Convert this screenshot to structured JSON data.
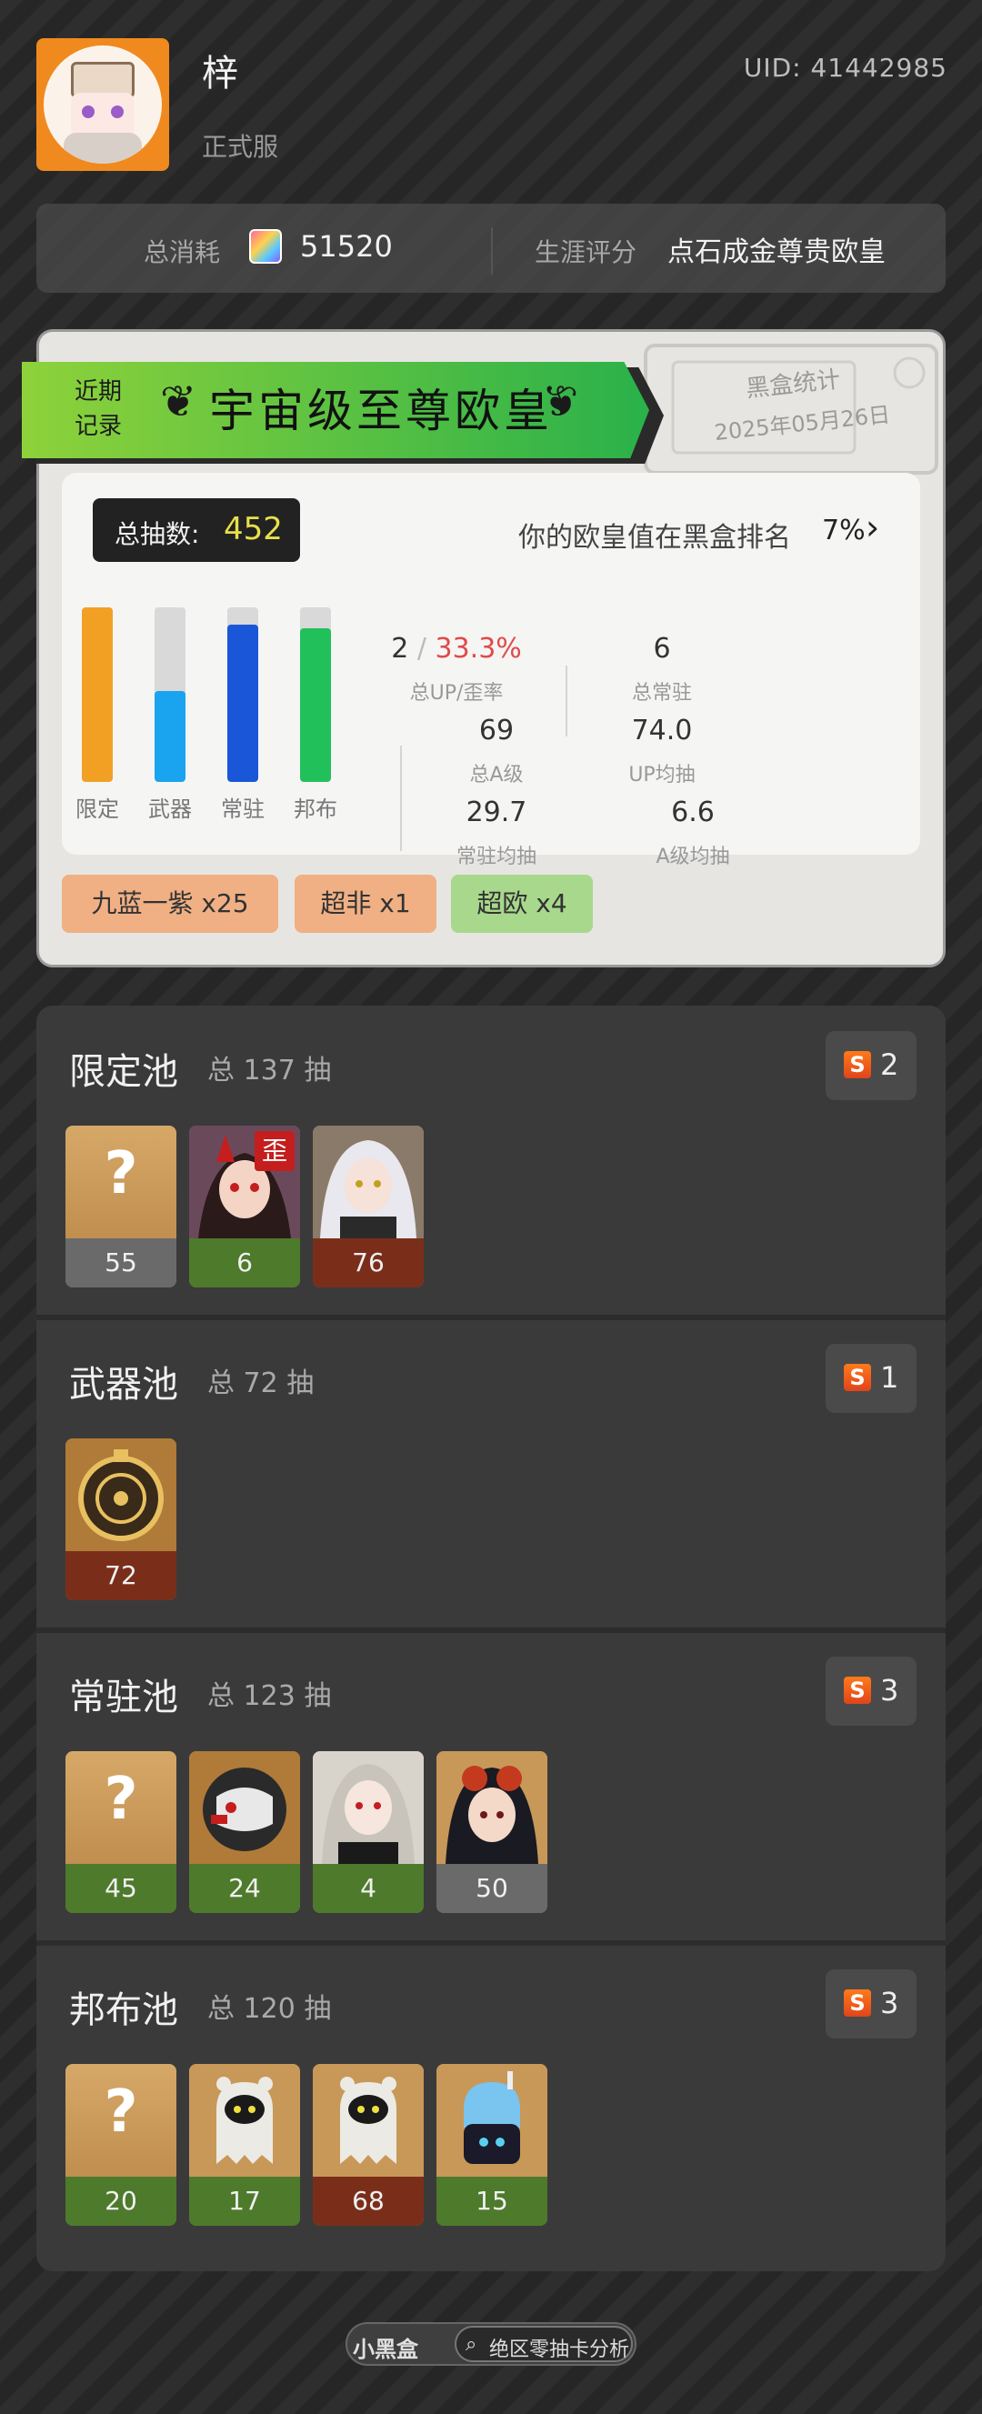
{
  "header": {
    "username": "梓",
    "server": "正式服",
    "uid": "UID: 41442985"
  },
  "stats": {
    "total_label": "总消耗",
    "total_value": "51520",
    "career_label": "生涯评分",
    "career_value": "点石成金尊贵欧皇"
  },
  "record": {
    "badge_line1": "近期",
    "badge_line2": "记录",
    "title": "宇宙级至尊欧皇",
    "stamp_title": "黑盒统计",
    "stamp_date": "2025年05月26日",
    "total_pulls_label": "总抽数:",
    "total_pulls": "452",
    "rank_text": "你的欧皇值在黑盒排名",
    "rank_pct": "7%",
    "bars": [
      {
        "label": "限定",
        "fill": 1.0,
        "color": "#f2a024"
      },
      {
        "label": "武器",
        "fill": 0.52,
        "color": "#1aa4f0"
      },
      {
        "label": "常驻",
        "fill": 0.9,
        "color": "#1a56d8"
      },
      {
        "label": "邦布",
        "fill": 0.88,
        "color": "#22c05a"
      }
    ],
    "s1_a": "2",
    "s1_slash": "/",
    "s1_b": "33.3%",
    "s1_label": "总UP/歪率",
    "s2_val": "6",
    "s2_label": "总常驻",
    "s3_val": "69",
    "s3_label": "总A级",
    "s4_val": "74.0",
    "s4_label": "UP均抽",
    "s5_val": "29.7",
    "s5_label": "常驻均抽",
    "s6_val": "6.6",
    "s6_label": "A级均抽",
    "tags": [
      {
        "text": "九蓝一紫 x25",
        "color": "#f0b084"
      },
      {
        "text": "超非 x1",
        "color": "#f0b084"
      },
      {
        "text": "超欧 x4",
        "color": "#a8d88c"
      }
    ]
  },
  "pools": [
    {
      "name": "限定池",
      "total": "总 137 抽",
      "s_icon": "S",
      "s_count": "2",
      "items": [
        {
          "kind": "unknown",
          "count": "55",
          "num_style": "gray"
        },
        {
          "kind": "agent-red-hair",
          "count": "6",
          "num_style": "green",
          "badge": "歪"
        },
        {
          "kind": "agent-white-hair",
          "count": "76",
          "num_style": "red"
        }
      ]
    },
    {
      "name": "武器池",
      "total": "总 72 抽",
      "s_icon": "S",
      "s_count": "1",
      "items": [
        {
          "kind": "engine-gold",
          "count": "72",
          "num_style": "red"
        }
      ]
    },
    {
      "name": "常驻池",
      "total": "总 123 抽",
      "s_icon": "S",
      "s_count": "3",
      "items": [
        {
          "kind": "unknown",
          "count": "45",
          "num_style": "green"
        },
        {
          "kind": "agent-robot",
          "count": "24",
          "num_style": "green"
        },
        {
          "kind": "agent-silver-hair",
          "count": "4",
          "num_style": "green"
        },
        {
          "kind": "agent-goggles",
          "count": "50",
          "num_style": "gray"
        }
      ]
    },
    {
      "name": "邦布池",
      "total": "总 120 抽",
      "s_icon": "S",
      "s_count": "3",
      "items": [
        {
          "kind": "unknown",
          "count": "20",
          "num_style": "green"
        },
        {
          "kind": "bangboo-ghost",
          "count": "17",
          "num_style": "green"
        },
        {
          "kind": "bangboo-ghost",
          "count": "68",
          "num_style": "red"
        },
        {
          "kind": "bangboo-blue",
          "count": "15",
          "num_style": "green"
        }
      ]
    }
  ],
  "footer": {
    "logo": "小黑盒",
    "link": "绝区零抽卡分析"
  }
}
